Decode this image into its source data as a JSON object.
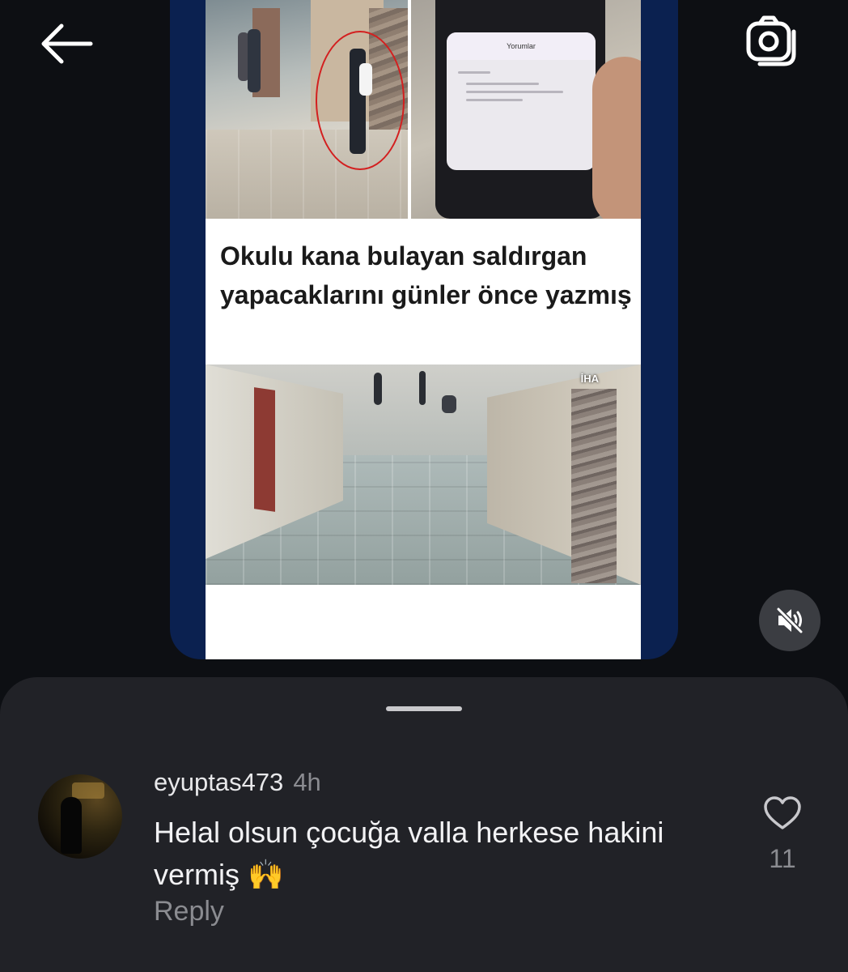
{
  "topbar": {
    "back_icon": "arrow-left-icon",
    "camera_icon": "camera-icon"
  },
  "video": {
    "headline": "Okulu kana bulayan saldırgan yapacaklarını günler önce yazmış",
    "watermark": "İHA",
    "phone_screen_title": "Yorumlar",
    "mute_icon": "speaker-muted-icon"
  },
  "comments": {
    "items": [
      {
        "username": "eyuptas473",
        "time": "4h",
        "text": "Helal olsun çocuğa valla herkese hakini vermiş 🙌",
        "reply_label": "Reply",
        "like_count": "11",
        "like_icon": "heart-outline-icon"
      }
    ]
  },
  "colors": {
    "background": "#0d0f13",
    "sheet": "#212227",
    "video_border": "#0b2150",
    "muted_text": "#8b8c91"
  }
}
